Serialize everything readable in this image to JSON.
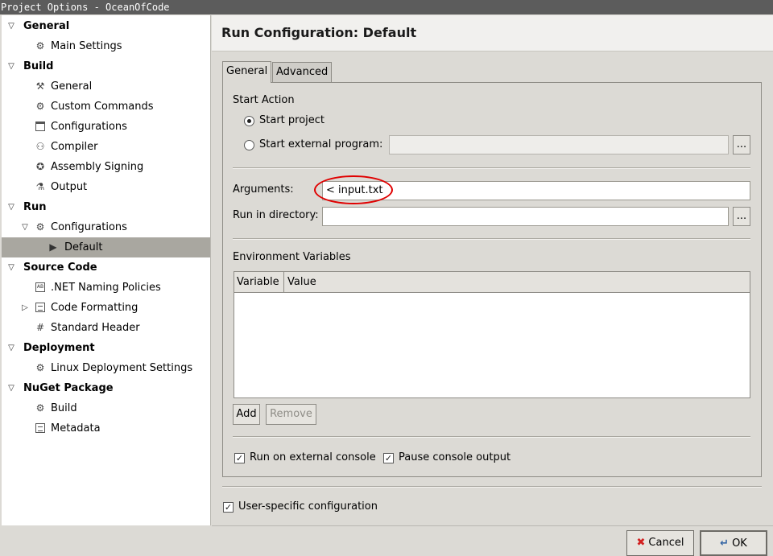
{
  "window": {
    "title": "Project Options - OceanOfCode"
  },
  "tree": {
    "general": {
      "label": "General",
      "children": {
        "main_settings": "Main Settings"
      }
    },
    "build": {
      "label": "Build",
      "children": {
        "general": "General",
        "custom_commands": "Custom Commands",
        "configurations": "Configurations",
        "compiler": "Compiler",
        "assembly_signing": "Assembly Signing",
        "output": "Output"
      }
    },
    "run": {
      "label": "Run",
      "configurations": "Configurations",
      "default": "Default"
    },
    "source_code": {
      "label": "Source Code",
      "children": {
        "naming": ".NET Naming Policies",
        "formatting": "Code Formatting",
        "header": "Standard Header"
      }
    },
    "deployment": {
      "label": "Deployment",
      "children": {
        "linux": "Linux Deployment Settings"
      }
    },
    "nuget": {
      "label": "NuGet Package",
      "children": {
        "build": "Build",
        "metadata": "Metadata"
      }
    }
  },
  "page": {
    "title": "Run Configuration: Default",
    "tabs": {
      "general": "General",
      "advanced": "Advanced"
    },
    "start_action": {
      "heading": "Start Action",
      "start_project": "Start project",
      "start_external": "Start external program:",
      "external_value": "",
      "browse": "..."
    },
    "arguments": {
      "label": "Arguments:",
      "value": "< input.txt"
    },
    "run_dir": {
      "label": "Run in directory:",
      "value": "",
      "browse": "..."
    },
    "env": {
      "heading": "Environment Variables",
      "columns": {
        "variable": "Variable",
        "value": "Value"
      },
      "add": "Add",
      "remove": "Remove"
    },
    "options": {
      "external_console": "Run on external console",
      "pause_output": "Pause console output"
    },
    "user_specific": "User-specific configuration"
  },
  "buttons": {
    "cancel": "Cancel",
    "ok": "OK"
  },
  "colors": {
    "selection": "#a9a7a0",
    "annotation": "#e00000",
    "cancel_icon": "#d21f1f",
    "ok_icon": "#3465a4"
  }
}
